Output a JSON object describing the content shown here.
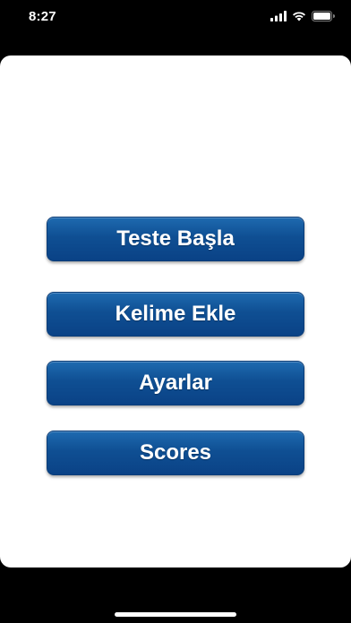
{
  "status_bar": {
    "time": "8:27",
    "icons": [
      "cellular-signal-icon",
      "wifi-icon",
      "battery-icon"
    ]
  },
  "menu": {
    "buttons": [
      {
        "label": "Teste Başla"
      },
      {
        "label": "Kelime Ekle"
      },
      {
        "label": "Ayarlar"
      },
      {
        "label": "Scores"
      }
    ]
  },
  "colors": {
    "button_top": "#1e6ab0",
    "button_bottom": "#0a4286",
    "sheet_background": "#ffffff",
    "screen_background": "#000000"
  }
}
